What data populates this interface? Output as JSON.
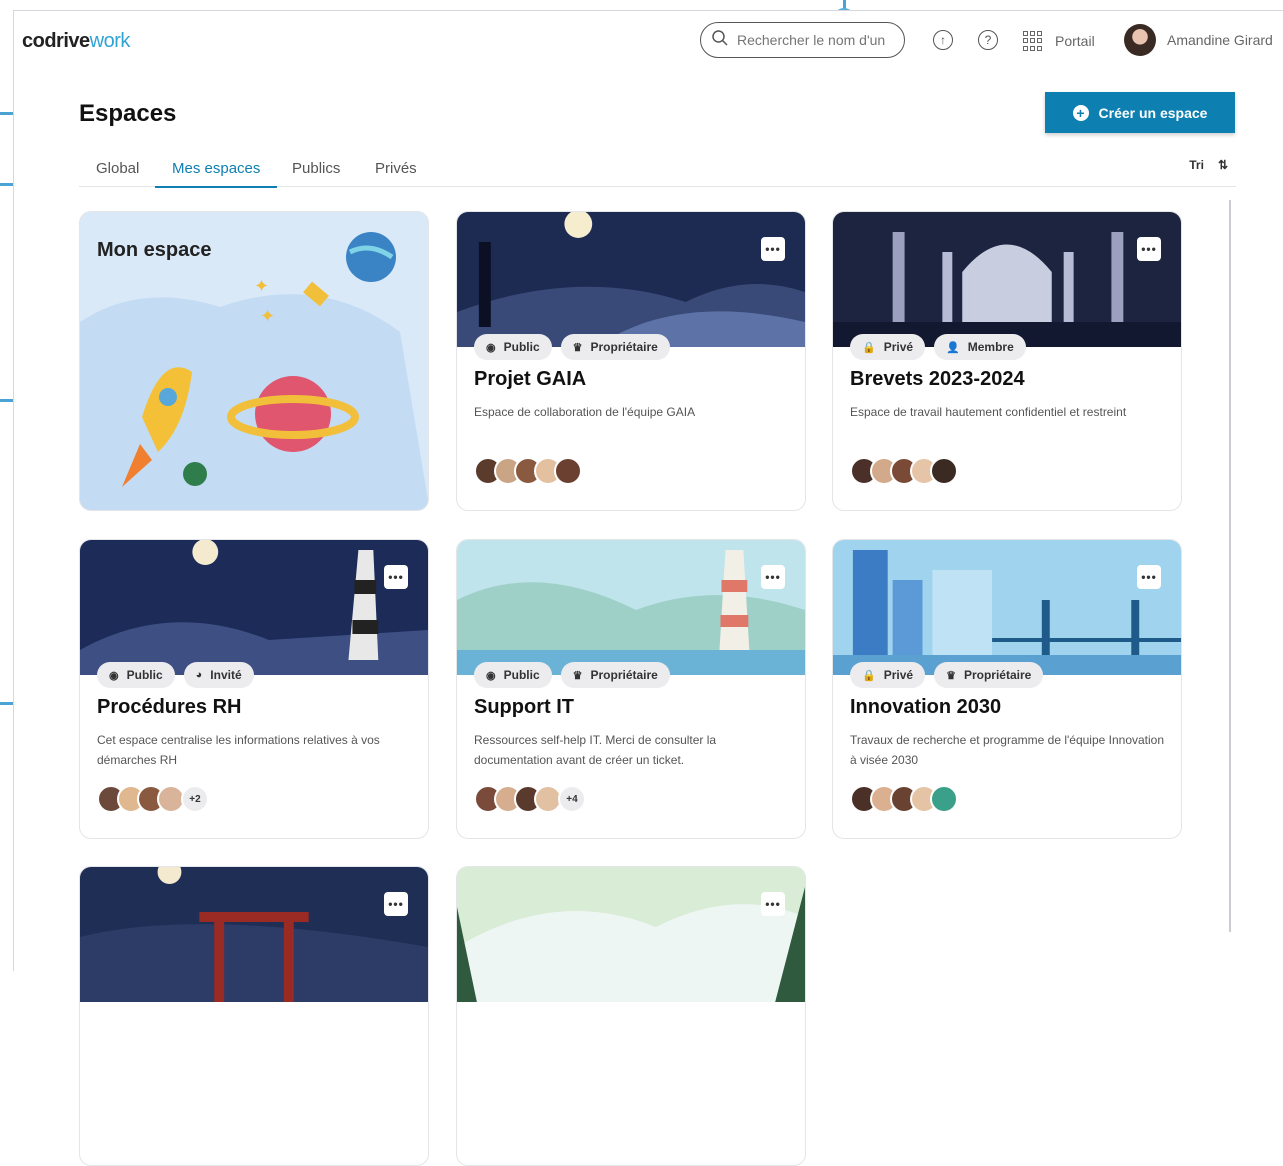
{
  "header": {
    "logo": {
      "main": "codrive",
      "accent": "work"
    },
    "search": {
      "placeholder": "Rechercher le nom d'un"
    },
    "upload_icon": "upload-icon",
    "help_icon": "help-icon",
    "portal_label": "Portail",
    "user_name": "Amandine Girard"
  },
  "page": {
    "title": "Espaces",
    "create_button": "Créer un espace"
  },
  "tabs": [
    {
      "label": "Global"
    },
    {
      "label": "Mes espaces",
      "active": true
    },
    {
      "label": "Publics"
    },
    {
      "label": "Privés"
    }
  ],
  "sort": {
    "label": "Tri"
  },
  "my_space": {
    "title": "Mon espace"
  },
  "cards": [
    {
      "title": "Projet GAIA",
      "description": "Espace de collaboration de l'équipe GAIA",
      "visibility": "Public",
      "role": "Propriétaire",
      "extra_members": ""
    },
    {
      "title": "Brevets 2023-2024",
      "description": "Espace de travail hautement confidentiel et restreint",
      "visibility": "Privé",
      "role": "Membre",
      "extra_members": ""
    },
    {
      "title": "Procédures RH",
      "description": "Cet espace centralise les informations relatives à vos démarches RH",
      "visibility": "Public",
      "role": "Invité",
      "extra_members": "+2"
    },
    {
      "title": "Support IT",
      "description": "Ressources self-help IT. Merci de consulter la documentation avant de créer un ticket.",
      "visibility": "Public",
      "role": "Propriétaire",
      "extra_members": "+4"
    },
    {
      "title": "Innovation 2030",
      "description": "Travaux de recherche et programme de l'équipe Innovation à visée 2030",
      "visibility": "Privé",
      "role": "Propriétaire",
      "extra_members": ""
    }
  ],
  "colors": {
    "accent": "#0e7fb1",
    "callout": "#5aaedc"
  }
}
